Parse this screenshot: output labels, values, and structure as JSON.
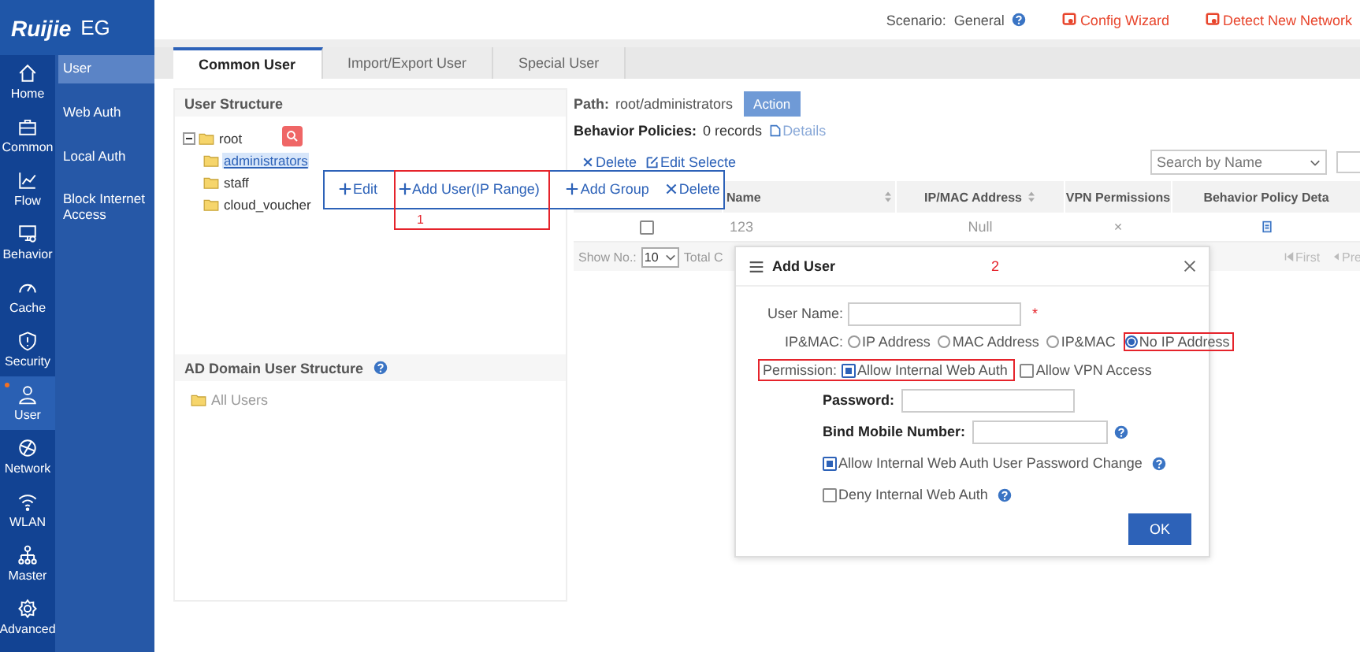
{
  "brand": {
    "logo": "Ruijie",
    "product": "EG"
  },
  "nav": [
    {
      "label": "Home",
      "selected": false
    },
    {
      "label": "Common",
      "selected": false
    },
    {
      "label": "Flow",
      "selected": false
    },
    {
      "label": "Behavior",
      "selected": false
    },
    {
      "label": "Cache",
      "selected": false
    },
    {
      "label": "Security",
      "selected": false
    },
    {
      "label": "User",
      "selected": true
    },
    {
      "label": "Network",
      "selected": false
    },
    {
      "label": "WLAN",
      "selected": false
    },
    {
      "label": "Master",
      "selected": false
    },
    {
      "label": "Advanced",
      "selected": false
    }
  ],
  "submenu": [
    {
      "label": "User",
      "selected": true
    },
    {
      "label": "Web Auth",
      "selected": false
    },
    {
      "label": "Local Auth",
      "selected": false
    },
    {
      "label": "Block Internet Access",
      "selected": false
    }
  ],
  "topbar": {
    "scenario_label": "Scenario:",
    "scenario_value": "General",
    "links": [
      "Config Wizard",
      "Detect New Network"
    ]
  },
  "tabs": [
    {
      "label": "Common User",
      "selected": true
    },
    {
      "label": "Import/Export User",
      "selected": false
    },
    {
      "label": "Special User",
      "selected": false
    }
  ],
  "user_structure": {
    "title": "User Structure",
    "tree": [
      {
        "label": "root",
        "expanded": true,
        "children": [
          {
            "label": "administrators",
            "selected": true
          },
          {
            "label": "staff",
            "selected": false
          },
          {
            "label": "cloud_voucher",
            "selected": false
          }
        ]
      }
    ]
  },
  "context_menu": [
    {
      "label": "Edit",
      "kind": "add",
      "highlighted": false
    },
    {
      "label": "Add User(IP Range)",
      "kind": "add",
      "highlighted": true,
      "note": "1"
    },
    {
      "label": "Add Group",
      "kind": "add",
      "highlighted": false
    },
    {
      "label": "Delete",
      "kind": "delete",
      "highlighted": false
    }
  ],
  "ad_domain": {
    "title": "AD Domain User Structure",
    "tree": [
      {
        "label": "All Users"
      }
    ]
  },
  "path": {
    "label": "Path:",
    "value": "root/administrators",
    "action": "Action"
  },
  "behavior_policies": {
    "label": "Behavior Policies:",
    "value": "0 records",
    "details": "Details"
  },
  "toolbar": [
    {
      "label": "Delete",
      "kind": "delete"
    },
    {
      "label": "Edit Selecte",
      "kind": "edit"
    }
  ],
  "search": {
    "value": "Search by Name"
  },
  "table": {
    "columns": [
      {
        "label": "Name",
        "sortable": true
      },
      {
        "label": "IP/MAC Address",
        "sortable": true
      },
      {
        "label": "VPN Permissions",
        "sortable": false
      },
      {
        "label": "Behavior Policy Deta",
        "sortable": false
      }
    ],
    "rows": [
      {
        "checked": false,
        "cells": [
          "123",
          "Null",
          "×"
        ]
      }
    ]
  },
  "pager": {
    "show_label": "Show No.:",
    "page_size": "10",
    "total": "Total C",
    "first": "First",
    "prev": "Pre"
  },
  "dialog": {
    "title": "Add User",
    "note": "2",
    "user_name": {
      "label": "User Name:",
      "required_mark": "*"
    },
    "ip_mac": {
      "label": "IP&MAC:",
      "options": [
        {
          "label": "IP Address",
          "selected": false,
          "highlighted": false
        },
        {
          "label": "MAC Address",
          "selected": false,
          "highlighted": false
        },
        {
          "label": "IP&MAC",
          "selected": false,
          "highlighted": false
        },
        {
          "label": "No IP Address",
          "selected": true,
          "highlighted": true
        }
      ]
    },
    "permission": {
      "label": "Permission:",
      "highlighted": true,
      "options": [
        {
          "label": "Allow Internal Web Auth",
          "checked": true
        },
        {
          "label": "Allow VPN Access",
          "checked": false
        }
      ]
    },
    "password": {
      "label": "Password:"
    },
    "mobile": {
      "label": "Bind Mobile Number:",
      "help": true
    },
    "checks": [
      {
        "label": "Allow Internal Web Auth User Password Change",
        "checked": true,
        "help": true
      },
      {
        "label": "Deny Internal Web Auth",
        "checked": false,
        "help": true
      }
    ],
    "ok": "OK"
  }
}
